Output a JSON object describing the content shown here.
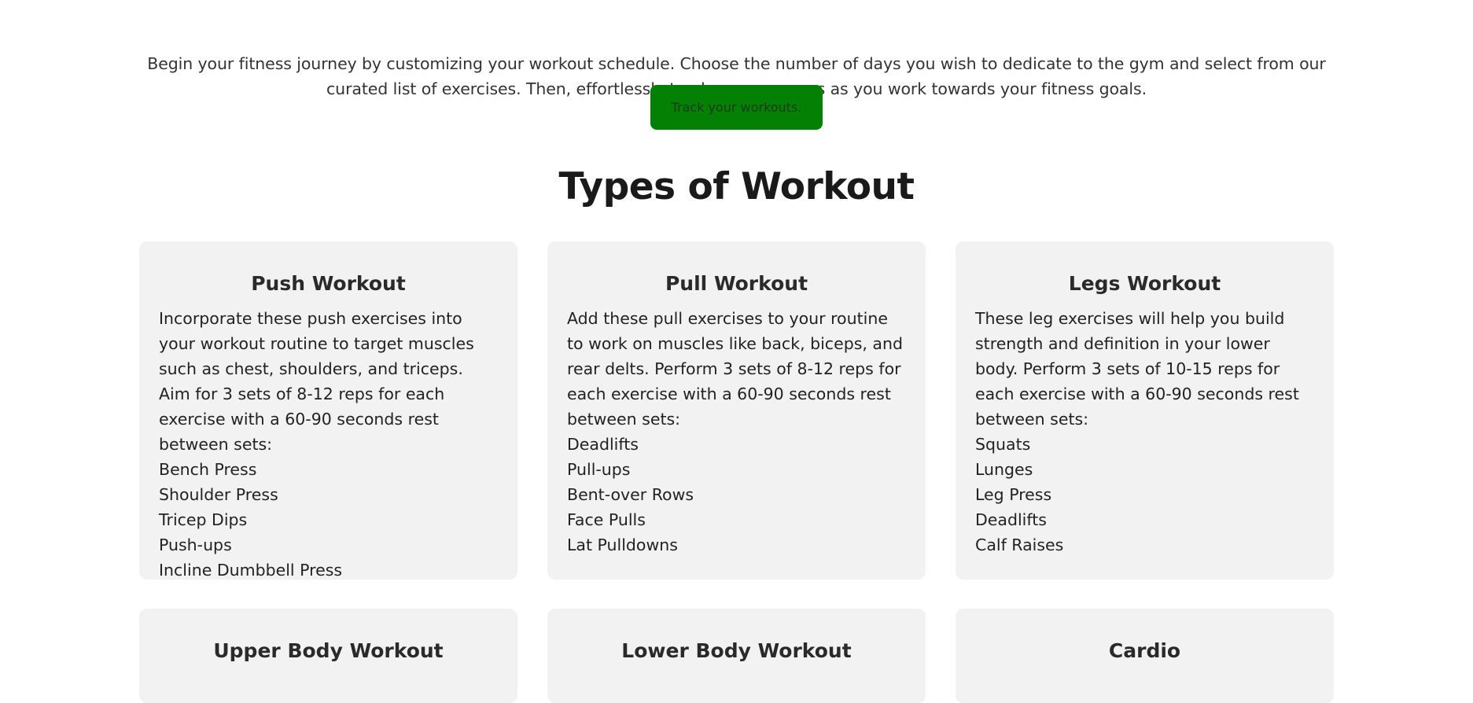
{
  "intro": {
    "text": "Begin your fitness journey by customizing your workout schedule. Choose the number of days you wish to dedicate to the gym and select from our curated list of exercises. Then, effortlessly track your progress as you work towards your fitness goals."
  },
  "cta": {
    "label": "Track your workouts."
  },
  "section": {
    "title": "Types of Workout"
  },
  "cards": [
    {
      "title": "Push Workout",
      "description": "Incorporate these push exercises into your workout routine to target muscles such as chest, shoulders, and triceps. Aim for 3 sets of 8-12 reps for each exercise with a 60-90 seconds rest between sets:",
      "exercises": [
        "Bench Press",
        "Shoulder Press",
        "Tricep Dips",
        "Push-ups",
        "Incline Dumbbell Press"
      ]
    },
    {
      "title": "Pull Workout",
      "description": "Add these pull exercises to your routine to work on muscles like back, biceps, and rear delts. Perform 3 sets of 8-12 reps for each exercise with a 60-90 seconds rest between sets:",
      "exercises": [
        "Deadlifts",
        "Pull-ups",
        "Bent-over Rows",
        "Face Pulls",
        "Lat Pulldowns"
      ]
    },
    {
      "title": "Legs Workout",
      "description": "These leg exercises will help you build strength and definition in your lower body. Perform 3 sets of 10-15 reps for each exercise with a 60-90 seconds rest between sets:",
      "exercises": [
        "Squats",
        "Lunges",
        "Leg Press",
        "Deadlifts",
        "Calf Raises"
      ]
    },
    {
      "title": "Upper Body Workout"
    },
    {
      "title": "Lower Body Workout"
    },
    {
      "title": "Cardio"
    }
  ],
  "colors": {
    "cta_background": "#048004",
    "card_background": "#f2f2f2"
  }
}
